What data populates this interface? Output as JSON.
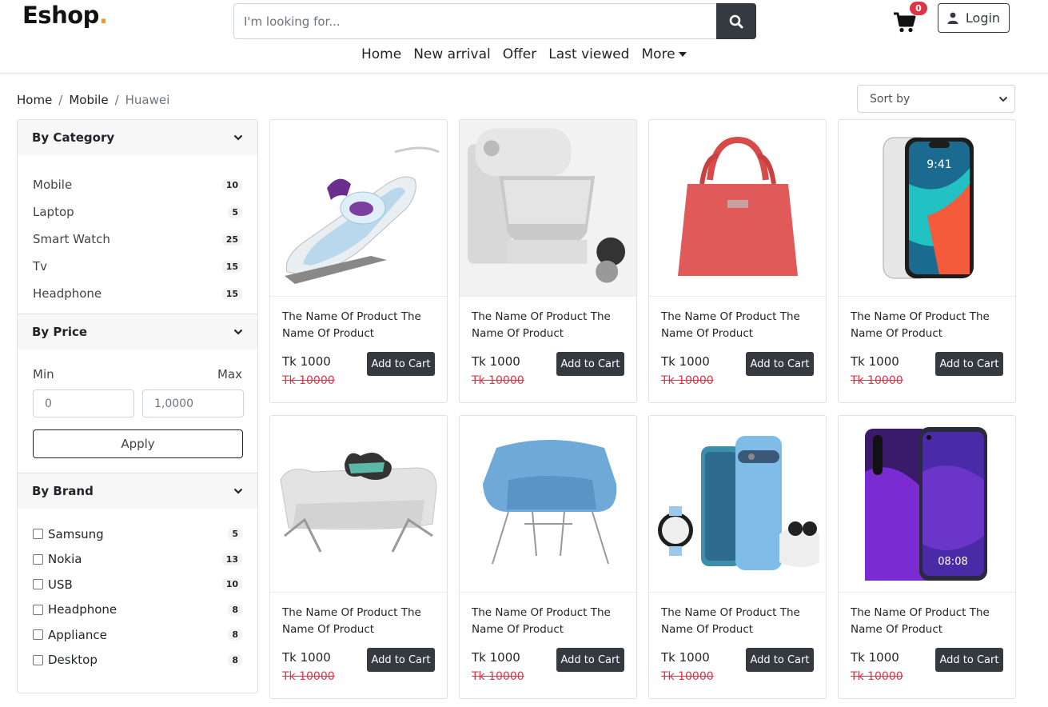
{
  "header": {
    "logo_text": "Eshop",
    "logo_dot": ".",
    "search_placeholder": "I'm looking for...",
    "cart_count": "0",
    "login_label": "Login"
  },
  "nav": {
    "items": [
      "Home",
      "New arrival",
      "Offer",
      "Last viewed"
    ],
    "more_label": "More"
  },
  "breadcrumb": {
    "items": [
      "Home",
      "Mobile",
      "Huawei"
    ]
  },
  "sort": {
    "selected": "Sort by"
  },
  "sidebar": {
    "category": {
      "title": "By Category",
      "items": [
        {
          "label": "Mobile",
          "count": "10"
        },
        {
          "label": "Laptop",
          "count": "5"
        },
        {
          "label": "Smart Watch",
          "count": "25"
        },
        {
          "label": "Tv",
          "count": "15"
        },
        {
          "label": "Headphone",
          "count": "15"
        }
      ]
    },
    "price": {
      "title": "By Price",
      "min_label": "Min",
      "max_label": "Max",
      "min_value": "0",
      "max_value": "1,0000",
      "apply_label": "Apply"
    },
    "brand": {
      "title": "By Brand",
      "items": [
        {
          "label": "Samsung",
          "count": "5"
        },
        {
          "label": "Nokia",
          "count": "13"
        },
        {
          "label": "USB",
          "count": "10"
        },
        {
          "label": "Headphone",
          "count": "8"
        },
        {
          "label": "Appliance",
          "count": "8"
        },
        {
          "label": "Desktop",
          "count": "8"
        }
      ]
    }
  },
  "products": [
    {
      "name": "The Name Of Product The Name Of Product",
      "price": "Tk 1000",
      "old_price": "Tk 10000",
      "button": "Add to Cart",
      "image": "iron"
    },
    {
      "name": "The Name Of Product The Name Of Product",
      "price": "Tk 1000",
      "old_price": "Tk 10000",
      "button": "Add to Cart",
      "image": "mixer"
    },
    {
      "name": "The Name Of Product The Name Of Product",
      "price": "Tk 1000",
      "old_price": "Tk 10000",
      "button": "Add to Cart",
      "image": "handbag"
    },
    {
      "name": "The Name Of Product The Name Of Product",
      "price": "Tk 1000",
      "old_price": "Tk 10000",
      "button": "Add to Cart",
      "image": "iphone"
    },
    {
      "name": "The Name Of Product The Name Of Product",
      "price": "Tk 1000",
      "old_price": "Tk 10000",
      "button": "Add to Cart",
      "image": "pet-bed"
    },
    {
      "name": "The Name Of Product The Name Of Product",
      "price": "Tk 1000",
      "old_price": "Tk 10000",
      "button": "Add to Cart",
      "image": "armchair"
    },
    {
      "name": "The Name Of Product The Name Of Product",
      "price": "Tk 1000",
      "old_price": "Tk 10000",
      "button": "Add to Cart",
      "image": "pixel-phones"
    },
    {
      "name": "The Name Of Product The Name Of Product",
      "price": "Tk 1000",
      "old_price": "Tk 10000",
      "button": "Add to Cart",
      "image": "huawei-phone"
    }
  ]
}
